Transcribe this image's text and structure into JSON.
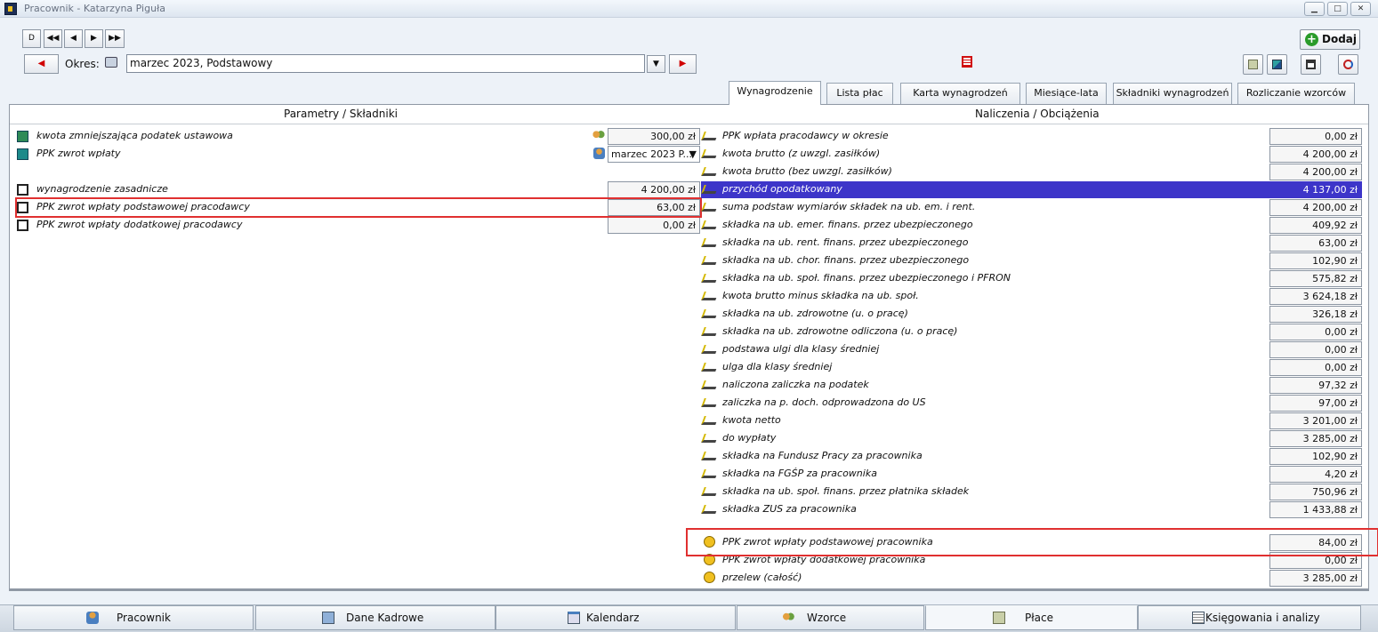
{
  "window": {
    "title": "Pracownik - Katarzyna Piguła",
    "min": "▁",
    "max": "□",
    "close": "✕"
  },
  "nav": {
    "new": "D",
    "first": "◀◀",
    "prev": "◀",
    "next": "▶",
    "last": "▶▶"
  },
  "add_label": "Dodaj",
  "period": {
    "label": "Okres:",
    "value": "marzec 2023, Podstawowy"
  },
  "tabs": [
    "Wynagrodzenie",
    "Lista płac",
    "Karta wynagrodzeń",
    "Miesiące-lata",
    "Składniki wynagrodzeń",
    "Rozliczanie wzorców"
  ],
  "active_tab": "Wynagrodzenie",
  "left_header": "Parametry / Składniki",
  "right_header": "Naliczenia / Obciążenia",
  "left_rows": [
    {
      "label": "kwota zmniejszająca podatek ustawowa",
      "value": "300,00 zł",
      "icon": "document-green-icon",
      "side_icon": "people-icon"
    },
    {
      "label": "PPK zwrot wpłaty",
      "value": "marzec 2023 P...",
      "icon": "calendar-teal-icon",
      "side_icon": "person-icon"
    },
    {
      "label": "wynagrodzenie zasadnicze",
      "value": "4 200,00 zł",
      "icon": "formula-icon"
    },
    {
      "label": "PPK zwrot wpłaty podstawowej pracodawcy",
      "value": "63,00 zł",
      "icon": "formula-icon"
    },
    {
      "label": "PPK zwrot wpłaty dodatkowej pracodawcy",
      "value": "0,00 zł",
      "icon": "formula-icon"
    }
  ],
  "right_rows": [
    {
      "label": "PPK wpłata pracodawcy w okresie",
      "value": "0,00 zł"
    },
    {
      "label": "kwota brutto (z uwzgl. zasiłków)",
      "value": "4 200,00 zł"
    },
    {
      "label": "kwota brutto (bez uwzgl. zasiłków)",
      "value": "4 200,00 zł"
    },
    {
      "label": "przychód opodatkowany",
      "value": "4 137,00 zł"
    },
    {
      "label": "suma podstaw wymiarów składek na ub. em. i rent.",
      "value": "4 200,00 zł"
    },
    {
      "label": "składka na ub. emer. finans. przez ubezpieczonego",
      "value": "409,92 zł"
    },
    {
      "label": "składka na ub. rent. finans. przez ubezpieczonego",
      "value": "63,00 zł"
    },
    {
      "label": "składka na ub. chor. finans. przez ubezpieczonego",
      "value": "102,90 zł"
    },
    {
      "label": "składka na ub. społ. finans. przez ubezpieczonego i PFRON",
      "value": "575,82 zł"
    },
    {
      "label": "kwota brutto minus składka na ub. społ.",
      "value": "3 624,18 zł"
    },
    {
      "label": "składka na ub. zdrowotne (u. o pracę)",
      "value": "326,18 zł"
    },
    {
      "label": "składka na ub. zdrowotne odliczona (u. o pracę)",
      "value": "0,00 zł"
    },
    {
      "label": "podstawa ulgi dla klasy średniej",
      "value": "0,00 zł"
    },
    {
      "label": "ulga dla klasy średniej",
      "value": "0,00 zł"
    },
    {
      "label": "naliczona zaliczka na podatek",
      "value": "97,32 zł"
    },
    {
      "label": "zaliczka na p. doch. odprowadzona do US",
      "value": "97,00 zł"
    },
    {
      "label": "kwota netto",
      "value": "3 201,00 zł"
    },
    {
      "label": "do wypłaty",
      "value": "3 285,00 zł"
    },
    {
      "label": "składka na Fundusz Pracy za pracownika",
      "value": "102,90 zł"
    },
    {
      "label": "składka na FGŚP za pracownika",
      "value": "4,20 zł"
    },
    {
      "label": "składka na ub. społ. finans. przez płatnika składek",
      "value": "750,96 zł"
    },
    {
      "label": "składka ZUS za pracownika",
      "value": "1 433,88 zł"
    }
  ],
  "right_rows_2": [
    {
      "label": "PPK zwrot wpłaty podstawowej pracownika",
      "value": "84,00 zł"
    },
    {
      "label": "PPK zwrot wpłaty dodatkowej pracownika",
      "value": "0,00 zł"
    },
    {
      "label": "przelew (całość)",
      "value": "3 285,00 zł"
    }
  ],
  "selected_row": "przychód opodatkowany",
  "bottom_tabs": [
    "Pracownik",
    "Dane Kadrowe",
    "Kalendarz",
    "Wzorce",
    "Płace",
    "Księgowania i analizy"
  ],
  "active_bottom_tab": "Płace",
  "colors": {
    "selection": "#3d35c9",
    "highlight": "#e03030",
    "arrow_red": "#d00000"
  }
}
